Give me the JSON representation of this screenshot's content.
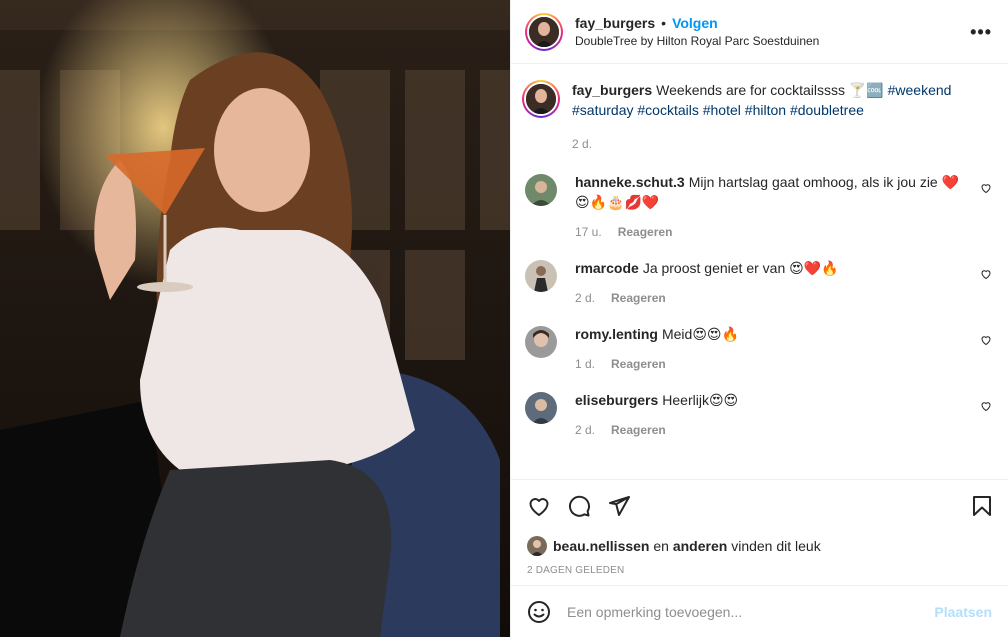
{
  "post": {
    "username": "fay_burgers",
    "separator": "•",
    "follow_label": "Volgen",
    "location": "DoubleTree by Hilton Royal Parc Soestduinen",
    "more_icon": "more-options-icon",
    "more_label": "•••"
  },
  "caption": {
    "username": "fay_burgers",
    "text": "Weekends are for cocktailssss 🍸🆒",
    "hashtags": [
      "#weekend",
      "#saturday",
      "#cocktails",
      "#hotel",
      "#hilton",
      "#doubletree"
    ],
    "time": "2 d."
  },
  "comments": [
    {
      "username": "hanneke.schut.3",
      "text": "Mijn hartslag gaat omhoog, als ik jou zie ❤️😍🔥🎂💋❤️",
      "time": "17 u.",
      "reply_label": "Reageren"
    },
    {
      "username": "rmarcode",
      "text": "Ja proost geniet er van 😍❤️🔥",
      "time": "2 d.",
      "reply_label": "Reageren"
    },
    {
      "username": "romy.lenting",
      "text": "Meid😍😍🔥",
      "time": "1 d.",
      "reply_label": "Reageren"
    },
    {
      "username": "eliseburgers",
      "text": "Heerlijk😍😍",
      "time": "2 d.",
      "reply_label": "Reageren"
    }
  ],
  "likes": {
    "user": "beau.nellissen",
    "connector": "en",
    "others": "anderen",
    "suffix": "vinden dit leuk"
  },
  "date_label": "2 DAGEN GELEDEN",
  "add_comment": {
    "placeholder": "Een opmerking toevoegen...",
    "post_label": "Plaatsen"
  },
  "colors": {
    "link_blue": "#0095f6",
    "hashtag": "#00376b",
    "muted": "#8e8e8e",
    "post_disabled": "#b2dffc"
  }
}
